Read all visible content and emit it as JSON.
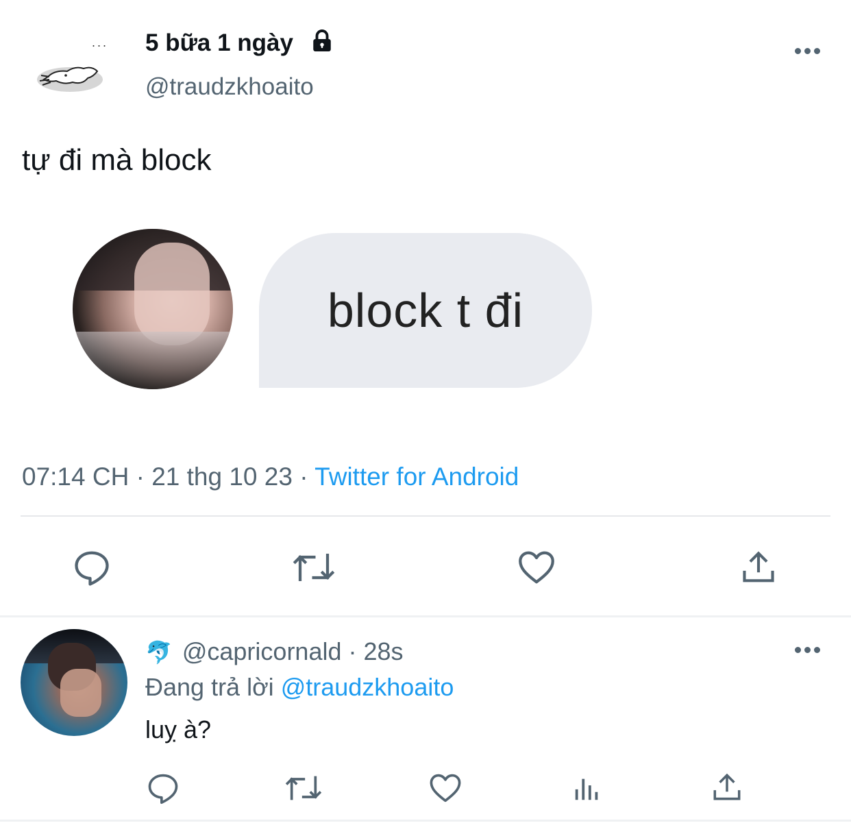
{
  "tweet": {
    "display_name": "5 bữa 1 ngày",
    "handle": "@traudzkhoaito",
    "avatar_dots": "...",
    "text": "tự đi mà block",
    "image_bubble_text": "block t đi",
    "time": "07:14 CH",
    "separator": " · ",
    "date": "21 thg 10 23",
    "source": "Twitter for Android"
  },
  "reply": {
    "emoji": "🐬",
    "handle": "@capricornald",
    "time": "· 28s",
    "replying_prefix": "Đang trả lời ",
    "replying_to": "@traudzkhoaito",
    "text": "luỵ à?"
  },
  "icons": {
    "lock": "lock-icon",
    "more": "more-icon",
    "reply": "reply-icon",
    "retweet": "retweet-icon",
    "like": "like-icon",
    "share": "share-icon",
    "views": "views-icon"
  },
  "colors": {
    "link": "#1d9bf0",
    "secondary_text": "#536471",
    "primary_text": "#0f1419",
    "icon": "#536471"
  }
}
